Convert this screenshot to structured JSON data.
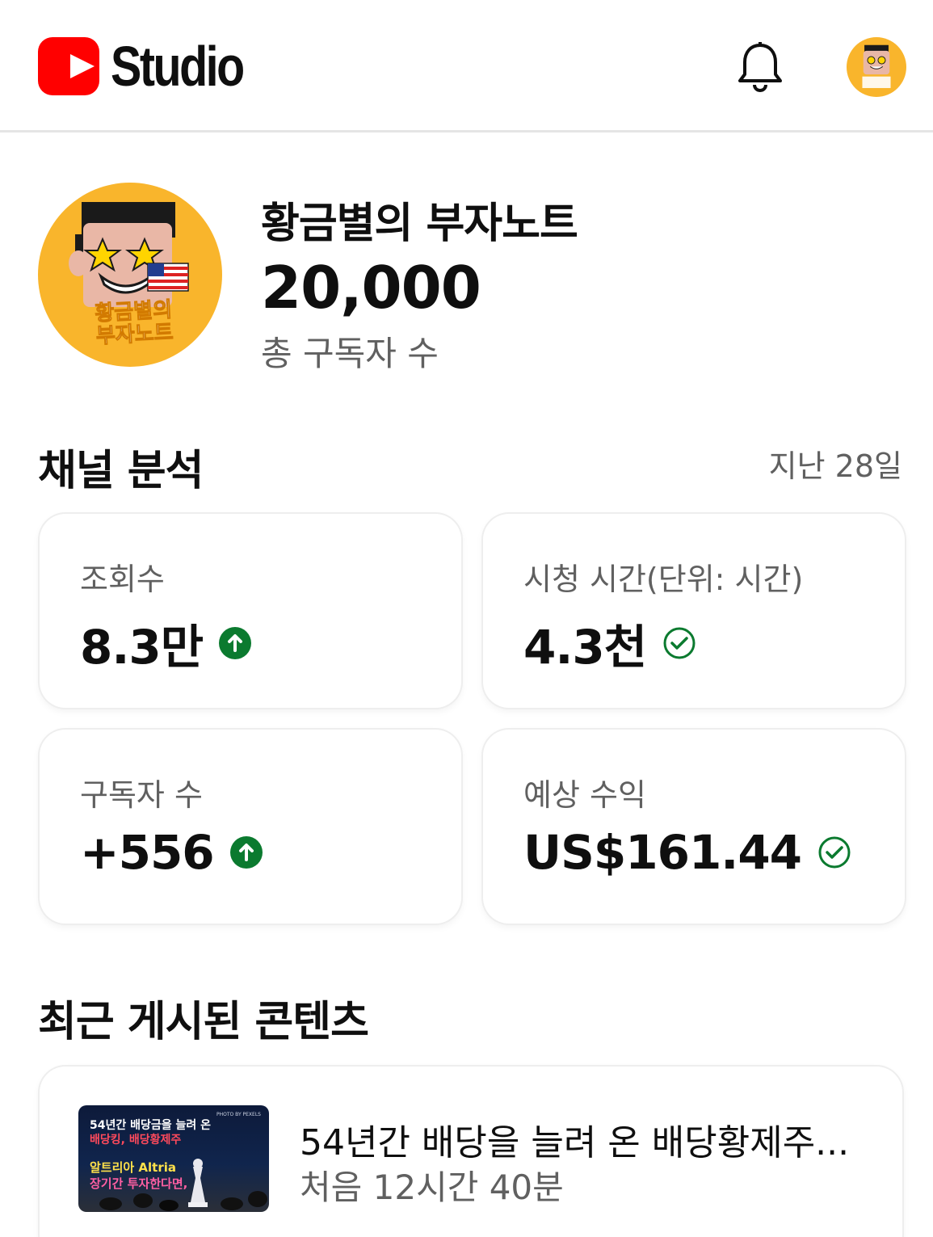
{
  "header": {
    "logo_text": "Studio",
    "icons": [
      "youtube-logo-icon",
      "bell-icon",
      "avatar"
    ]
  },
  "channel": {
    "name": "황금별의 부자노트",
    "subscriber_count": "20,000",
    "subscriber_label": "총 구독자 수",
    "avatar_text_line1": "황금별의",
    "avatar_text_line2": "부자노트"
  },
  "analytics": {
    "title": "채널 분석",
    "range": "지난 28일",
    "cards": [
      {
        "label": "조회수",
        "value": "8.3만",
        "indicator": "arrow-up-circle-icon"
      },
      {
        "label": "시청 시간(단위: 시간)",
        "value": "4.3천",
        "indicator": "check-circle-icon"
      },
      {
        "label": "구독자 수",
        "value": "+556",
        "indicator": "arrow-up-circle-icon"
      },
      {
        "label": "예상 수익",
        "value": "US$161.44",
        "indicator": "check-circle-icon"
      }
    ]
  },
  "recent": {
    "title": "최근 게시된 콘텐츠",
    "video": {
      "title": "54년간 배당을 늘려 온 배당황제주...",
      "meta": "처음 12시간 40분",
      "thumbnail": {
        "line1": "54년간 배당금을 늘려 온",
        "line2": "배당킹, 배당황제주",
        "line3": "알트리아 Altria",
        "line4": "장기간 투자한다면,",
        "small": "PHOTO BY PEXELS"
      }
    }
  },
  "colors": {
    "brand_red": "#ff0000",
    "success_green": "#0b7a2f",
    "avatar_bg": "#f9b52c"
  }
}
